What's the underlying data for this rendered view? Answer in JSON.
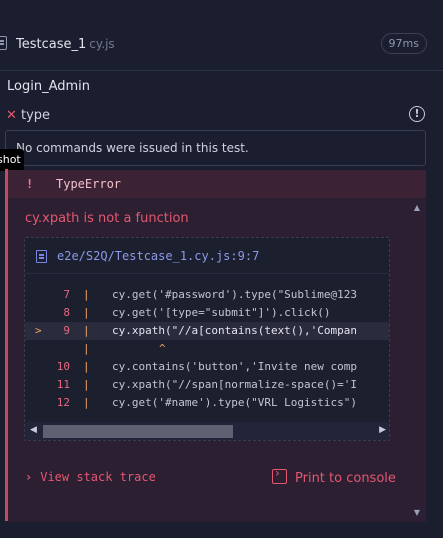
{
  "file": {
    "name": "Testcase_1",
    "ext": "cy.js",
    "duration": "97ms"
  },
  "suite": {
    "title": "Login_Admin"
  },
  "test": {
    "name": "type",
    "info_icon": "!"
  },
  "commands": {
    "empty_message": "No commands were issued in this test."
  },
  "screenshot_tab": {
    "label": "shot"
  },
  "error": {
    "bang": "!",
    "type": "TypeError",
    "message": "cy.xpath is not a function",
    "code_frame": {
      "file_link": "e2e/S2Q/Testcase_1.cy.js:9:7",
      "lines": [
        {
          "num": "7",
          "marker": "",
          "code": "cy.get('#password').type(\"Sublime@123"
        },
        {
          "num": "8",
          "marker": "",
          "code": "cy.get('[type=\"submit\"]').click()"
        },
        {
          "num": "9",
          "marker": ">",
          "code": "cy.xpath(\"//a[contains(text(),'Compan"
        },
        {
          "num": "",
          "marker": "",
          "code": "",
          "caret": "^"
        },
        {
          "num": "10",
          "marker": "",
          "code": "cy.contains('button','Invite new comp"
        },
        {
          "num": "11",
          "marker": "",
          "code": "cy.xpath(\"//span[normalize-space()='I"
        },
        {
          "num": "12",
          "marker": "",
          "code": "cy.get('#name').type(\"VRL Logistics\")"
        }
      ]
    },
    "stack_trace_label": "View stack trace",
    "print_console_label": "Print to console"
  },
  "colors": {
    "error_accent": "#e45770",
    "panel_bg": "#2b1f31",
    "app_bg": "#1b1e2e"
  }
}
